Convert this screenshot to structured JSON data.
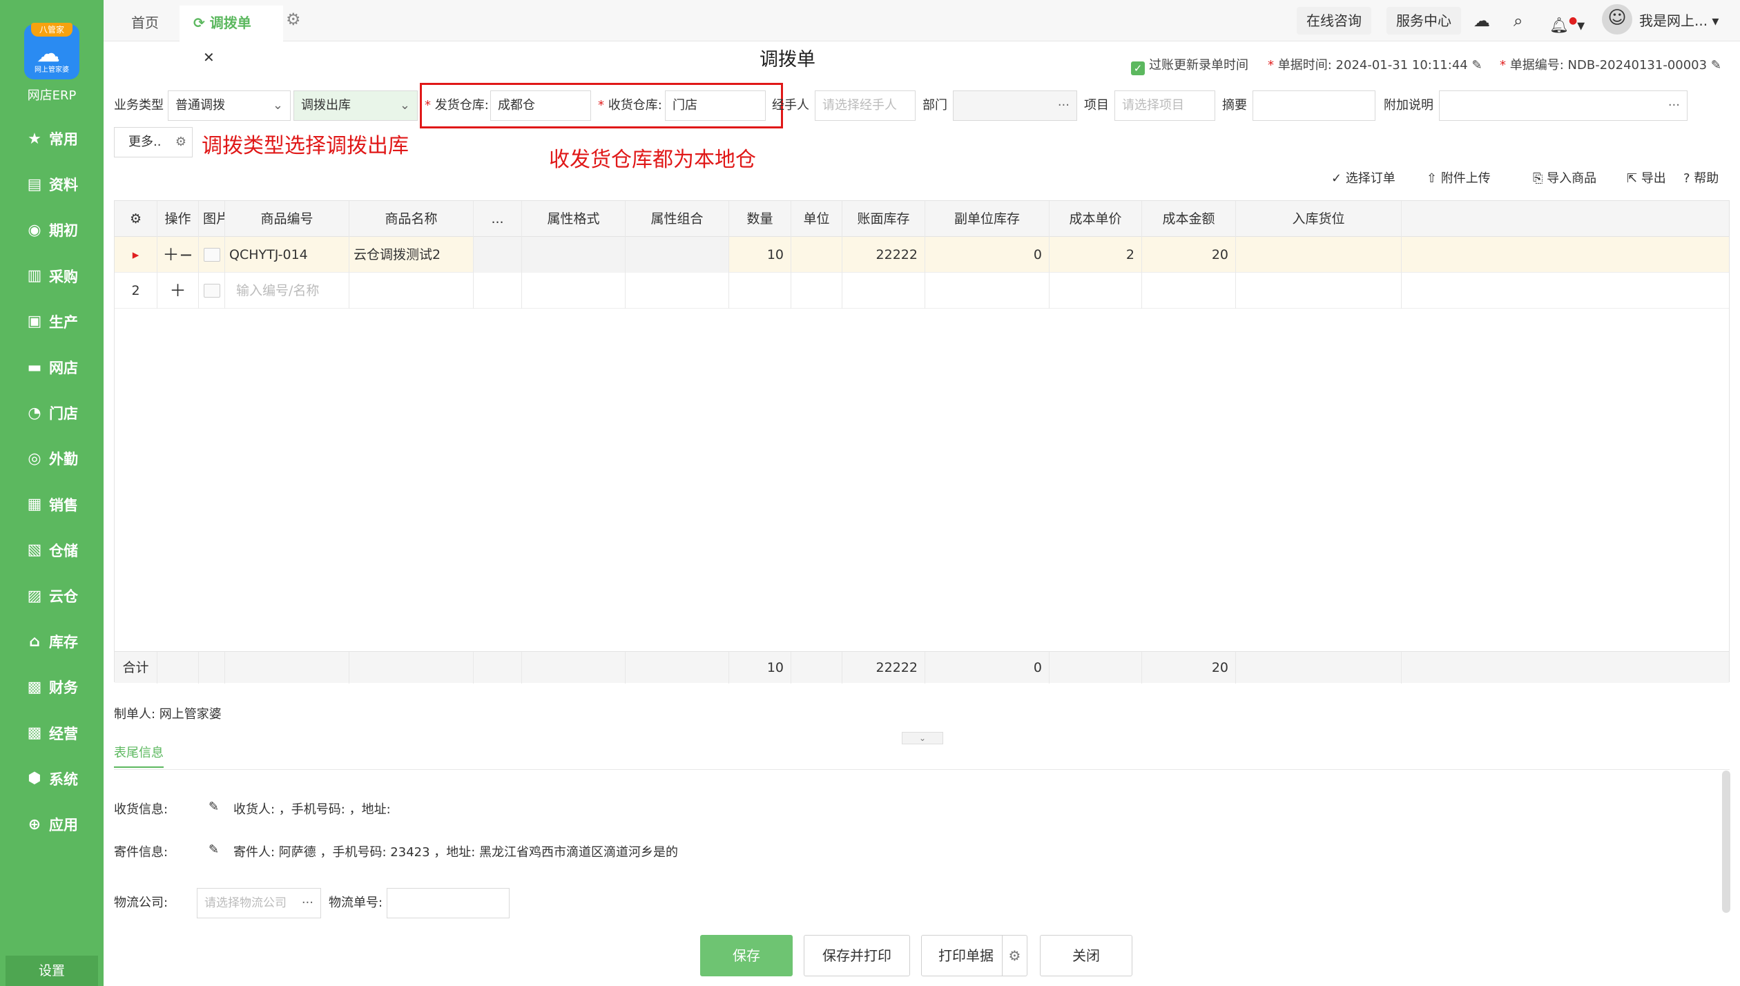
{
  "sidebar": {
    "logo_badge": "八管家",
    "logo_sub": "网上管家婆",
    "brand": "网店ERP",
    "items": [
      {
        "label": "常用",
        "icon": "★"
      },
      {
        "label": "资料",
        "icon": "▤"
      },
      {
        "label": "期初",
        "icon": "◉"
      },
      {
        "label": "采购",
        "icon": "▥"
      },
      {
        "label": "生产",
        "icon": "▣"
      },
      {
        "label": "网店",
        "icon": "▬"
      },
      {
        "label": "门店",
        "icon": "◔"
      },
      {
        "label": "外勤",
        "icon": "◎"
      },
      {
        "label": "销售",
        "icon": "▦"
      },
      {
        "label": "仓储",
        "icon": "▧"
      },
      {
        "label": "云仓",
        "icon": "▨"
      },
      {
        "label": "库存",
        "icon": "⌂"
      },
      {
        "label": "财务",
        "icon": "▩"
      },
      {
        "label": "经营",
        "icon": "▩"
      },
      {
        "label": "系统",
        "icon": "⬢"
      },
      {
        "label": "应用",
        "icon": "⊕"
      }
    ],
    "settings": "设置"
  },
  "tabs": {
    "home": "首页",
    "active": "调拨单"
  },
  "topbar": {
    "consult": "在线咨询",
    "service": "服务中心",
    "user": "我是网上..."
  },
  "page": {
    "title": "调拨单",
    "post_update": "过账更新录单时间",
    "doc_time_label": "单据时间:",
    "doc_time": "2024-01-31 10:11:44",
    "doc_no_label": "单据编号:",
    "doc_no": "NDB-20240131-00003"
  },
  "form": {
    "biz_type_label": "业务类型",
    "biz_type": "普通调拨",
    "sub_type": "调拨出库",
    "send_wh_label": "发货仓库:",
    "send_wh": "成都仓",
    "recv_wh_label": "收货仓库:",
    "recv_wh": "门店",
    "handler_label": "经手人",
    "handler_ph": "请选择经手人",
    "dept_label": "部门",
    "project_label": "项目",
    "project_ph": "请选择项目",
    "summary_label": "摘要",
    "extra_label": "附加说明",
    "more": "更多.."
  },
  "annotations": {
    "a1": "调拨类型选择调拨出库",
    "a2": "收发货仓库都为本地仓"
  },
  "toolbar": {
    "select_order": "选择订单",
    "attach": "附件上传",
    "import": "导入商品",
    "export": "导出",
    "help": "帮助"
  },
  "table": {
    "headers": [
      "操作",
      "图片",
      "商品编号",
      "商品名称",
      "...",
      "属性格式",
      "属性组合",
      "数量",
      "单位",
      "账面库存",
      "副单位库存",
      "成本单价",
      "成本金额",
      "入库货位"
    ],
    "row1": {
      "code": "QCHYTJ-014",
      "name": "云仓调拨测试2",
      "qty": "10",
      "stock": "22222",
      "sub_stock": "0",
      "price": "2",
      "amount": "20"
    },
    "row2": {
      "no": "2",
      "placeholder": "输入编号/名称"
    },
    "footer": {
      "label": "合计",
      "qty": "10",
      "stock": "22222",
      "sub_stock": "0",
      "amount": "20"
    }
  },
  "maker": "制单人: 网上管家婆",
  "tail": {
    "tab": "表尾信息",
    "recv_label": "收货信息:",
    "recv_info": "收货人: ，手机号码: ，地址:",
    "send_label": "寄件信息:",
    "send_info": "寄件人: 阿萨德 ，手机号码: 23423 ，地址: 黑龙江省鸡西市滴道区滴道河乡是的",
    "logistics_label": "物流公司:",
    "logistics_ph": "请选择物流公司",
    "tracking_label": "物流单号:"
  },
  "buttons": {
    "save": "保存",
    "save_print": "保存并打印",
    "print": "打印单据",
    "close": "关闭"
  }
}
